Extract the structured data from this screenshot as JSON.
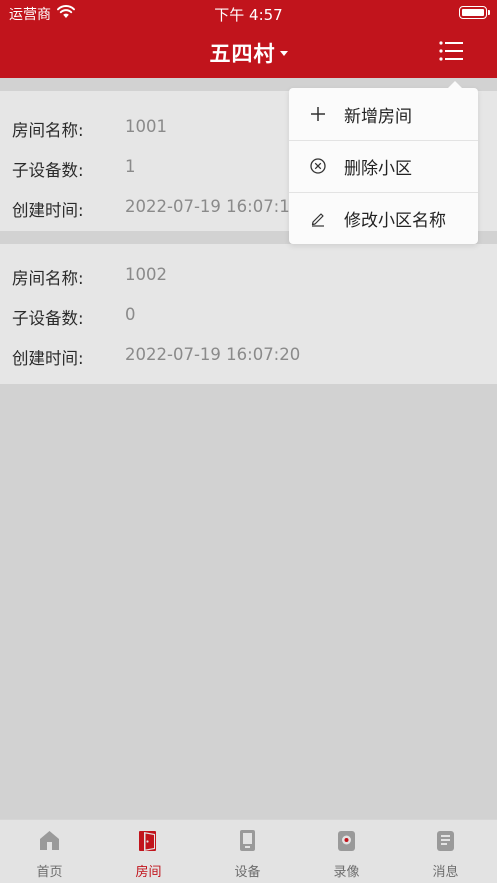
{
  "status_bar": {
    "carrier": "运营商",
    "time": "下午 4:57"
  },
  "nav": {
    "title": "五四村"
  },
  "rooms": [
    {
      "name_label": "房间名称:",
      "name": "1001",
      "devices_label": "子设备数:",
      "devices": "1",
      "created_label": "创建时间:",
      "created": "2022-07-19 16:07:10"
    },
    {
      "name_label": "房间名称:",
      "name": "1002",
      "devices_label": "子设备数:",
      "devices": "0",
      "created_label": "创建时间:",
      "created": "2022-07-19 16:07:20"
    }
  ],
  "menu": {
    "items": [
      {
        "label": "新增房间",
        "icon": "plus-icon"
      },
      {
        "label": "删除小区",
        "icon": "circle-x-icon"
      },
      {
        "label": "修改小区名称",
        "icon": "pencil-icon"
      }
    ]
  },
  "tabs": [
    {
      "label": "首页",
      "icon": "home-icon",
      "active": false
    },
    {
      "label": "房间",
      "icon": "door-icon",
      "active": true
    },
    {
      "label": "设备",
      "icon": "device-icon",
      "active": false
    },
    {
      "label": "录像",
      "icon": "record-icon",
      "active": false
    },
    {
      "label": "消息",
      "icon": "message-icon",
      "active": false
    }
  ],
  "colors": {
    "brand": "#c1141c",
    "card_bg": "#e6e6e6",
    "page_bg": "#d2d2d2"
  }
}
